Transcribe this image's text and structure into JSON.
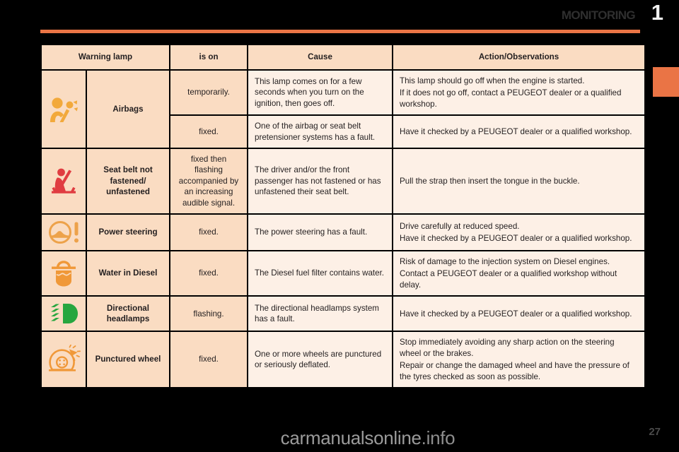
{
  "header": {
    "chapter_title": "MONITORING",
    "chapter_number": "1"
  },
  "table": {
    "columns": [
      "Warning lamp",
      "is on",
      "Cause",
      "Action/Observations"
    ],
    "rows": [
      {
        "icon": "airbag-icon",
        "icon_color": "#f2a93b",
        "name": "Airbags",
        "is_on": "temporarily.",
        "cause": [
          "This lamp comes on for a few seconds when you turn on the ignition, then goes off."
        ],
        "action": [
          "This lamp should go off when the engine is started.",
          "If it does not go off, contact a PEUGEOT dealer or a qualified workshop."
        ]
      },
      {
        "icon": "airbag-icon",
        "icon_color": "#f2a93b",
        "name": "Airbags",
        "is_on": "fixed.",
        "cause": [
          "One of the airbag or seat belt pretensioner systems has a fault."
        ],
        "action": [
          "Have it checked by a PEUGEOT dealer or a qualified workshop."
        ]
      },
      {
        "icon": "seat-belt-icon",
        "icon_color": "#e03c41",
        "name": "Seat belt not fastened/ unfastened",
        "is_on": "fixed then flashing accompanied by an increasing audible signal.",
        "cause": [
          "The driver and/or the front passenger has not fastened or has unfastened their seat belt."
        ],
        "action": [
          "Pull the strap then insert the tongue in the buckle."
        ]
      },
      {
        "icon": "power-steering-icon",
        "icon_color": "#eda24a",
        "name": "Power steering",
        "is_on": "fixed.",
        "cause": [
          "The power steering has a fault."
        ],
        "action": [
          "Drive carefully at reduced speed.",
          "Have it checked by a PEUGEOT dealer or a qualified workshop."
        ]
      },
      {
        "icon": "water-in-diesel-icon",
        "icon_color": "#f09838",
        "name": "Water in Diesel",
        "is_on": "fixed.",
        "cause": [
          "The Diesel fuel filter contains water."
        ],
        "action": [
          "Risk of damage to the injection system on Diesel engines.",
          "Contact a PEUGEOT dealer or a qualified workshop without delay."
        ]
      },
      {
        "icon": "directional-headlamps-icon",
        "icon_color": "#27a63f",
        "name": "Directional headlamps",
        "is_on": "flashing.",
        "cause": [
          "The directional headlamps system has a fault."
        ],
        "action": [
          "Have it checked by a PEUGEOT dealer or a qualified workshop."
        ]
      },
      {
        "icon": "punctured-wheel-icon",
        "icon_color": "#f09838",
        "name": "Punctured wheel",
        "is_on": "fixed.",
        "cause": [
          "One or more wheels are punctured or seriously deflated."
        ],
        "action": [
          "Stop immediately avoiding any sharp action on the steering wheel or the brakes.",
          "Repair or change the damaged wheel and have the pressure of the tyres checked as soon as possible."
        ]
      }
    ]
  },
  "footer": {
    "watermark": "carmanualsonline",
    "watermark_tld": ".info",
    "page_number": "27"
  },
  "colors": {
    "accent_orange": "#ea7445",
    "header_cell": "#fadcc2",
    "body_cell": "#fdf0e6",
    "page_background": "#000000"
  }
}
